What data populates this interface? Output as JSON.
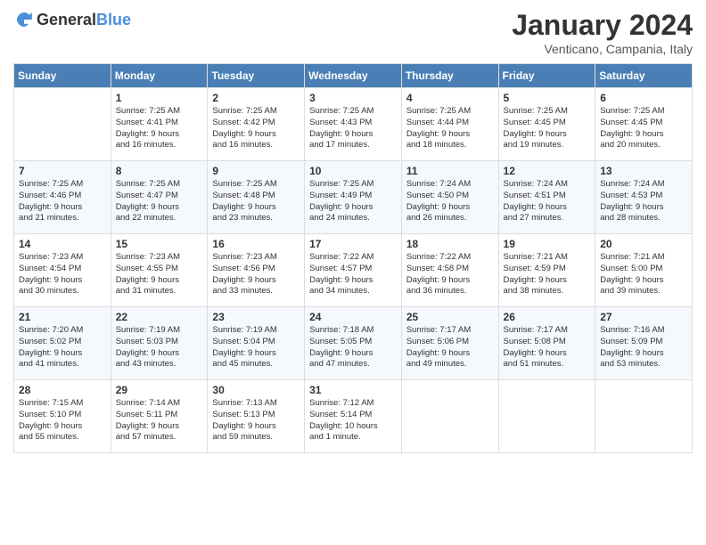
{
  "header": {
    "logo_general": "General",
    "logo_blue": "Blue",
    "month_title": "January 2024",
    "location": "Venticano, Campania, Italy"
  },
  "days_header": [
    "Sunday",
    "Monday",
    "Tuesday",
    "Wednesday",
    "Thursday",
    "Friday",
    "Saturday"
  ],
  "weeks": [
    [
      {
        "day": "",
        "lines": []
      },
      {
        "day": "1",
        "lines": [
          "Sunrise: 7:25 AM",
          "Sunset: 4:41 PM",
          "Daylight: 9 hours",
          "and 16 minutes."
        ]
      },
      {
        "day": "2",
        "lines": [
          "Sunrise: 7:25 AM",
          "Sunset: 4:42 PM",
          "Daylight: 9 hours",
          "and 16 minutes."
        ]
      },
      {
        "day": "3",
        "lines": [
          "Sunrise: 7:25 AM",
          "Sunset: 4:43 PM",
          "Daylight: 9 hours",
          "and 17 minutes."
        ]
      },
      {
        "day": "4",
        "lines": [
          "Sunrise: 7:25 AM",
          "Sunset: 4:44 PM",
          "Daylight: 9 hours",
          "and 18 minutes."
        ]
      },
      {
        "day": "5",
        "lines": [
          "Sunrise: 7:25 AM",
          "Sunset: 4:45 PM",
          "Daylight: 9 hours",
          "and 19 minutes."
        ]
      },
      {
        "day": "6",
        "lines": [
          "Sunrise: 7:25 AM",
          "Sunset: 4:45 PM",
          "Daylight: 9 hours",
          "and 20 minutes."
        ]
      }
    ],
    [
      {
        "day": "7",
        "lines": [
          "Sunrise: 7:25 AM",
          "Sunset: 4:46 PM",
          "Daylight: 9 hours",
          "and 21 minutes."
        ]
      },
      {
        "day": "8",
        "lines": [
          "Sunrise: 7:25 AM",
          "Sunset: 4:47 PM",
          "Daylight: 9 hours",
          "and 22 minutes."
        ]
      },
      {
        "day": "9",
        "lines": [
          "Sunrise: 7:25 AM",
          "Sunset: 4:48 PM",
          "Daylight: 9 hours",
          "and 23 minutes."
        ]
      },
      {
        "day": "10",
        "lines": [
          "Sunrise: 7:25 AM",
          "Sunset: 4:49 PM",
          "Daylight: 9 hours",
          "and 24 minutes."
        ]
      },
      {
        "day": "11",
        "lines": [
          "Sunrise: 7:24 AM",
          "Sunset: 4:50 PM",
          "Daylight: 9 hours",
          "and 26 minutes."
        ]
      },
      {
        "day": "12",
        "lines": [
          "Sunrise: 7:24 AM",
          "Sunset: 4:51 PM",
          "Daylight: 9 hours",
          "and 27 minutes."
        ]
      },
      {
        "day": "13",
        "lines": [
          "Sunrise: 7:24 AM",
          "Sunset: 4:53 PM",
          "Daylight: 9 hours",
          "and 28 minutes."
        ]
      }
    ],
    [
      {
        "day": "14",
        "lines": [
          "Sunrise: 7:23 AM",
          "Sunset: 4:54 PM",
          "Daylight: 9 hours",
          "and 30 minutes."
        ]
      },
      {
        "day": "15",
        "lines": [
          "Sunrise: 7:23 AM",
          "Sunset: 4:55 PM",
          "Daylight: 9 hours",
          "and 31 minutes."
        ]
      },
      {
        "day": "16",
        "lines": [
          "Sunrise: 7:23 AM",
          "Sunset: 4:56 PM",
          "Daylight: 9 hours",
          "and 33 minutes."
        ]
      },
      {
        "day": "17",
        "lines": [
          "Sunrise: 7:22 AM",
          "Sunset: 4:57 PM",
          "Daylight: 9 hours",
          "and 34 minutes."
        ]
      },
      {
        "day": "18",
        "lines": [
          "Sunrise: 7:22 AM",
          "Sunset: 4:58 PM",
          "Daylight: 9 hours",
          "and 36 minutes."
        ]
      },
      {
        "day": "19",
        "lines": [
          "Sunrise: 7:21 AM",
          "Sunset: 4:59 PM",
          "Daylight: 9 hours",
          "and 38 minutes."
        ]
      },
      {
        "day": "20",
        "lines": [
          "Sunrise: 7:21 AM",
          "Sunset: 5:00 PM",
          "Daylight: 9 hours",
          "and 39 minutes."
        ]
      }
    ],
    [
      {
        "day": "21",
        "lines": [
          "Sunrise: 7:20 AM",
          "Sunset: 5:02 PM",
          "Daylight: 9 hours",
          "and 41 minutes."
        ]
      },
      {
        "day": "22",
        "lines": [
          "Sunrise: 7:19 AM",
          "Sunset: 5:03 PM",
          "Daylight: 9 hours",
          "and 43 minutes."
        ]
      },
      {
        "day": "23",
        "lines": [
          "Sunrise: 7:19 AM",
          "Sunset: 5:04 PM",
          "Daylight: 9 hours",
          "and 45 minutes."
        ]
      },
      {
        "day": "24",
        "lines": [
          "Sunrise: 7:18 AM",
          "Sunset: 5:05 PM",
          "Daylight: 9 hours",
          "and 47 minutes."
        ]
      },
      {
        "day": "25",
        "lines": [
          "Sunrise: 7:17 AM",
          "Sunset: 5:06 PM",
          "Daylight: 9 hours",
          "and 49 minutes."
        ]
      },
      {
        "day": "26",
        "lines": [
          "Sunrise: 7:17 AM",
          "Sunset: 5:08 PM",
          "Daylight: 9 hours",
          "and 51 minutes."
        ]
      },
      {
        "day": "27",
        "lines": [
          "Sunrise: 7:16 AM",
          "Sunset: 5:09 PM",
          "Daylight: 9 hours",
          "and 53 minutes."
        ]
      }
    ],
    [
      {
        "day": "28",
        "lines": [
          "Sunrise: 7:15 AM",
          "Sunset: 5:10 PM",
          "Daylight: 9 hours",
          "and 55 minutes."
        ]
      },
      {
        "day": "29",
        "lines": [
          "Sunrise: 7:14 AM",
          "Sunset: 5:11 PM",
          "Daylight: 9 hours",
          "and 57 minutes."
        ]
      },
      {
        "day": "30",
        "lines": [
          "Sunrise: 7:13 AM",
          "Sunset: 5:13 PM",
          "Daylight: 9 hours",
          "and 59 minutes."
        ]
      },
      {
        "day": "31",
        "lines": [
          "Sunrise: 7:12 AM",
          "Sunset: 5:14 PM",
          "Daylight: 10 hours",
          "and 1 minute."
        ]
      },
      {
        "day": "",
        "lines": []
      },
      {
        "day": "",
        "lines": []
      },
      {
        "day": "",
        "lines": []
      }
    ]
  ]
}
